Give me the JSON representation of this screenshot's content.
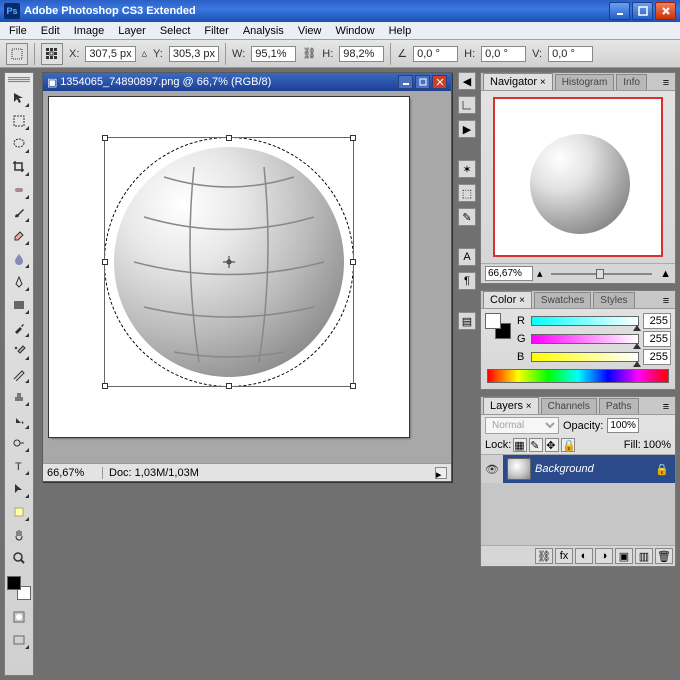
{
  "app": {
    "title": "Adobe Photoshop CS3 Extended",
    "logo": "Ps"
  },
  "menu": [
    "File",
    "Edit",
    "Image",
    "Layer",
    "Select",
    "Filter",
    "Analysis",
    "View",
    "Window",
    "Help"
  ],
  "options": {
    "x_label": "X:",
    "x": "307,5 px",
    "y_label": "Y:",
    "y": "305,3 px",
    "w_label": "W:",
    "w": "95,1%",
    "h_label": "H:",
    "h": "98,2%",
    "angle_label": "∠",
    "angle": "0,0 °",
    "h_skew_label": "H:",
    "h_skew": "0,0 °",
    "v_skew_label": "V:",
    "v_skew": "0,0 °"
  },
  "document": {
    "title": "1354065_74890897.png @ 66,7% (RGB/8)",
    "zoom": "66,67%",
    "doc_info": "Doc: 1,03M/1,03M"
  },
  "navigator": {
    "zoom": "66,67%"
  },
  "panel_tabs": {
    "nav": [
      "Navigator",
      "Histogram",
      "Info"
    ],
    "color": [
      "Color",
      "Swatches",
      "Styles"
    ],
    "layers": [
      "Layers",
      "Channels",
      "Paths"
    ]
  },
  "color": {
    "r_label": "R",
    "g_label": "G",
    "b_label": "B",
    "r": "255",
    "g": "255",
    "b": "255"
  },
  "layers": {
    "blend": "Normal",
    "opacity_label": "Opacity:",
    "opacity": "100%",
    "lock_label": "Lock:",
    "fill_label": "Fill:",
    "fill": "100%",
    "items": [
      {
        "name": "Background"
      }
    ]
  }
}
